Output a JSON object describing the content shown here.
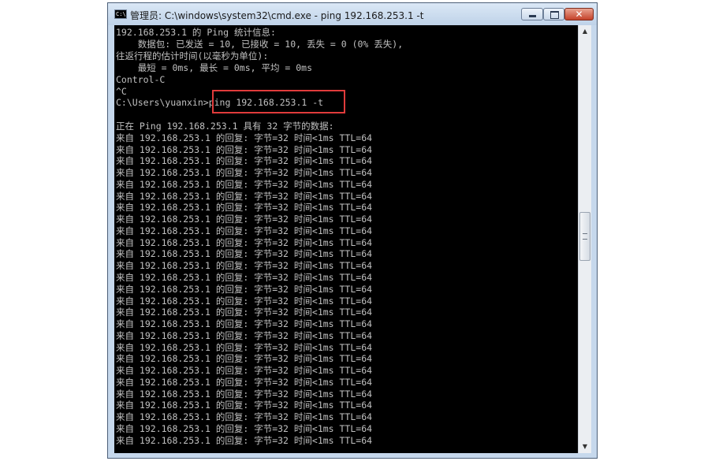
{
  "window": {
    "title": "管理员: C:\\windows\\system32\\cmd.exe - ping  192.168.253.1 -t",
    "icon_label": "C:\\"
  },
  "console": {
    "lines": [
      "192.168.253.1 的 Ping 统计信息:",
      "    数据包: 已发送 = 10, 已接收 = 10, 丢失 = 0 (0% 丢失),",
      "往返行程的估计时间(以毫秒为单位):",
      "    最短 = 0ms, 最长 = 0ms, 平均 = 0ms",
      "Control-C",
      "^C",
      "C:\\Users\\yuanxin>ping 192.168.253.1 -t",
      "",
      "正在 Ping 192.168.253.1 具有 32 字节的数据:",
      "来自 192.168.253.1 的回复: 字节=32 时间<1ms TTL=64",
      "来自 192.168.253.1 的回复: 字节=32 时间<1ms TTL=64",
      "来自 192.168.253.1 的回复: 字节=32 时间<1ms TTL=64",
      "来自 192.168.253.1 的回复: 字节=32 时间<1ms TTL=64",
      "来自 192.168.253.1 的回复: 字节=32 时间<1ms TTL=64",
      "来自 192.168.253.1 的回复: 字节=32 时间<1ms TTL=64",
      "来自 192.168.253.1 的回复: 字节=32 时间<1ms TTL=64",
      "来自 192.168.253.1 的回复: 字节=32 时间<1ms TTL=64",
      "来自 192.168.253.1 的回复: 字节=32 时间<1ms TTL=64",
      "来自 192.168.253.1 的回复: 字节=32 时间<1ms TTL=64",
      "来自 192.168.253.1 的回复: 字节=32 时间<1ms TTL=64",
      "来自 192.168.253.1 的回复: 字节=32 时间<1ms TTL=64",
      "来自 192.168.253.1 的回复: 字节=32 时间<1ms TTL=64",
      "来自 192.168.253.1 的回复: 字节=32 时间<1ms TTL=64",
      "来自 192.168.253.1 的回复: 字节=32 时间<1ms TTL=64",
      "来自 192.168.253.1 的回复: 字节=32 时间<1ms TTL=64",
      "来自 192.168.253.1 的回复: 字节=32 时间<1ms TTL=64",
      "来自 192.168.253.1 的回复: 字节=32 时间<1ms TTL=64",
      "来自 192.168.253.1 的回复: 字节=32 时间<1ms TTL=64",
      "来自 192.168.253.1 的回复: 字节=32 时间<1ms TTL=64",
      "来自 192.168.253.1 的回复: 字节=32 时间<1ms TTL=64",
      "来自 192.168.253.1 的回复: 字节=32 时间<1ms TTL=64",
      "来自 192.168.253.1 的回复: 字节=32 时间<1ms TTL=64",
      "来自 192.168.253.1 的回复: 字节=32 时间<1ms TTL=64",
      "来自 192.168.253.1 的回复: 字节=32 时间<1ms TTL=64",
      "来自 192.168.253.1 的回复: 字节=32 时间<1ms TTL=64",
      "来自 192.168.253.1 的回复: 字节=32 时间<1ms TTL=64"
    ]
  },
  "colors": {
    "console_bg": "#000000",
    "console_text": "#c0c0c0",
    "highlight_border": "#e03b3b",
    "close_button": "#c4412a"
  },
  "icons": {
    "minimize": "minimize-icon",
    "maximize": "maximize-icon",
    "close": "close-icon",
    "scroll_up": "chevron-up-icon",
    "scroll_down": "chevron-down-icon"
  }
}
